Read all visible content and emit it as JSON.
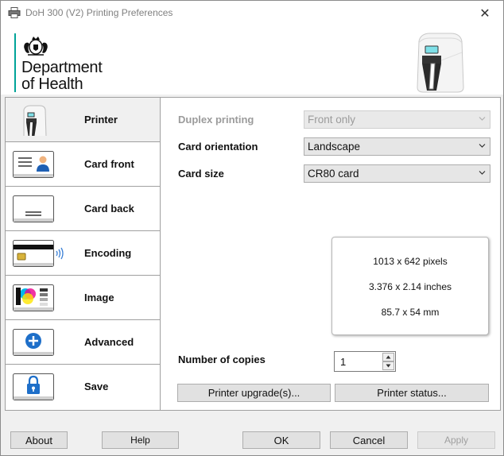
{
  "window": {
    "title": "DoH 300 (V2) Printing Preferences",
    "close_glyph": "✕"
  },
  "header": {
    "dept_line1": "Department",
    "dept_line2": "of Health",
    "accent": "#00a499"
  },
  "nav": {
    "items": [
      {
        "label": "Printer",
        "icon": "printer-icon"
      },
      {
        "label": "Card front",
        "icon": "card-front-icon"
      },
      {
        "label": "Card back",
        "icon": "card-back-icon"
      },
      {
        "label": "Encoding",
        "icon": "encoding-icon"
      },
      {
        "label": "Image",
        "icon": "image-icon"
      },
      {
        "label": "Advanced",
        "icon": "advanced-icon"
      },
      {
        "label": "Save",
        "icon": "lock-icon"
      }
    ],
    "active": "Printer"
  },
  "printer_panel": {
    "duplex_label": "Duplex printing",
    "duplex_value": "Front only",
    "orientation_label": "Card orientation",
    "orientation_value": "Landscape",
    "size_label": "Card size",
    "size_value": "CR80 card",
    "card_info": {
      "pixels": "1013 x 642 pixels",
      "inches": "3.376 x 2.14 inches",
      "mm": "85.7 x 54 mm"
    },
    "copies_label": "Number of copies",
    "copies_value": "1",
    "upgrade_button": "Printer upgrade(s)...",
    "status_button": "Printer status..."
  },
  "footer": {
    "about": "About",
    "help": "Help",
    "ok": "OK",
    "cancel": "Cancel",
    "apply": "Apply"
  }
}
